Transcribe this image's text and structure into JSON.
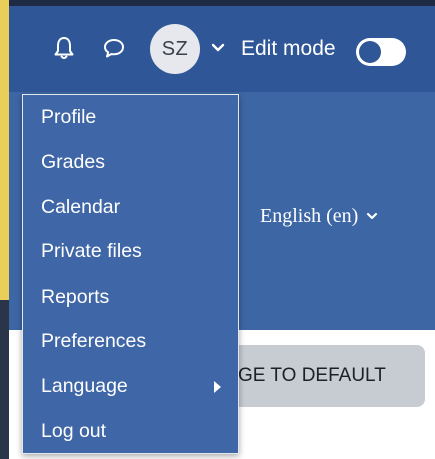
{
  "navbar": {
    "avatar_initials": "SZ",
    "edit_mode_label": "Edit mode",
    "edit_mode_on": false
  },
  "banner": {
    "language_selector": "English (en)"
  },
  "content": {
    "reset_button_partial": "GE TO DEFAULT"
  },
  "user_menu": {
    "items": [
      {
        "label": "Profile"
      },
      {
        "label": "Grades"
      },
      {
        "label": "Calendar"
      },
      {
        "label": "Private files"
      },
      {
        "label": "Reports"
      },
      {
        "label": "Preferences"
      },
      {
        "label": "Language",
        "has_submenu": true
      },
      {
        "label": "Log out"
      }
    ]
  },
  "colors": {
    "navbar_bg": "#2f5797",
    "banner_bg": "#3d66a4",
    "menu_bg": "#3f66a6",
    "accent_yellow": "#e9cf5a"
  },
  "icons": {
    "notifications": "bell-icon",
    "messages": "chat-bubble-icon",
    "user_menu_toggle": "chevron-down-icon",
    "language_caret": "chevron-down-icon",
    "submenu": "caret-right-icon"
  }
}
